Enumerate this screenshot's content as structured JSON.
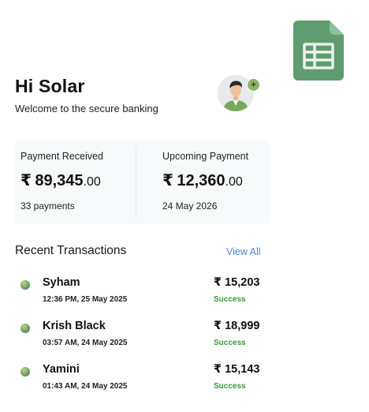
{
  "header": {
    "greeting": "Hi Solar",
    "subtitle": "Welcome to the secure banking",
    "avatar_badge": "+"
  },
  "summary": {
    "received": {
      "label": "Payment Received",
      "currency": "₹",
      "amount_main": "89,345",
      "amount_decimal": ".00",
      "meta": "33 payments"
    },
    "upcoming": {
      "label": "Upcoming Payment",
      "currency": "₹",
      "amount_main": "12,360",
      "amount_decimal": ".00",
      "meta": "24 May 2026"
    }
  },
  "transactions": {
    "title": "Recent Transactions",
    "view_all": "View All",
    "items": [
      {
        "name": "Syham",
        "time": "12:36 PM, 25 May 2025",
        "amount": "₹ 15,203",
        "status": "Success"
      },
      {
        "name": "Krish Black",
        "time": "03:57 AM, 24 May 2025",
        "amount": "₹ 18,999",
        "status": "Success"
      },
      {
        "name": "Yamini",
        "time": "01:43 AM, 24 May 2025",
        "amount": "₹ 15,143",
        "status": "Success"
      }
    ]
  },
  "colors": {
    "accent_link": "#4a86d8",
    "success": "#3a9a3a",
    "sheet_icon": "#5f9c6f",
    "card_bg": "#f8f9fb"
  },
  "icons": {
    "top_right": "spreadsheet-icon",
    "avatar": "user-avatar",
    "badge": "plus-badge-icon"
  }
}
